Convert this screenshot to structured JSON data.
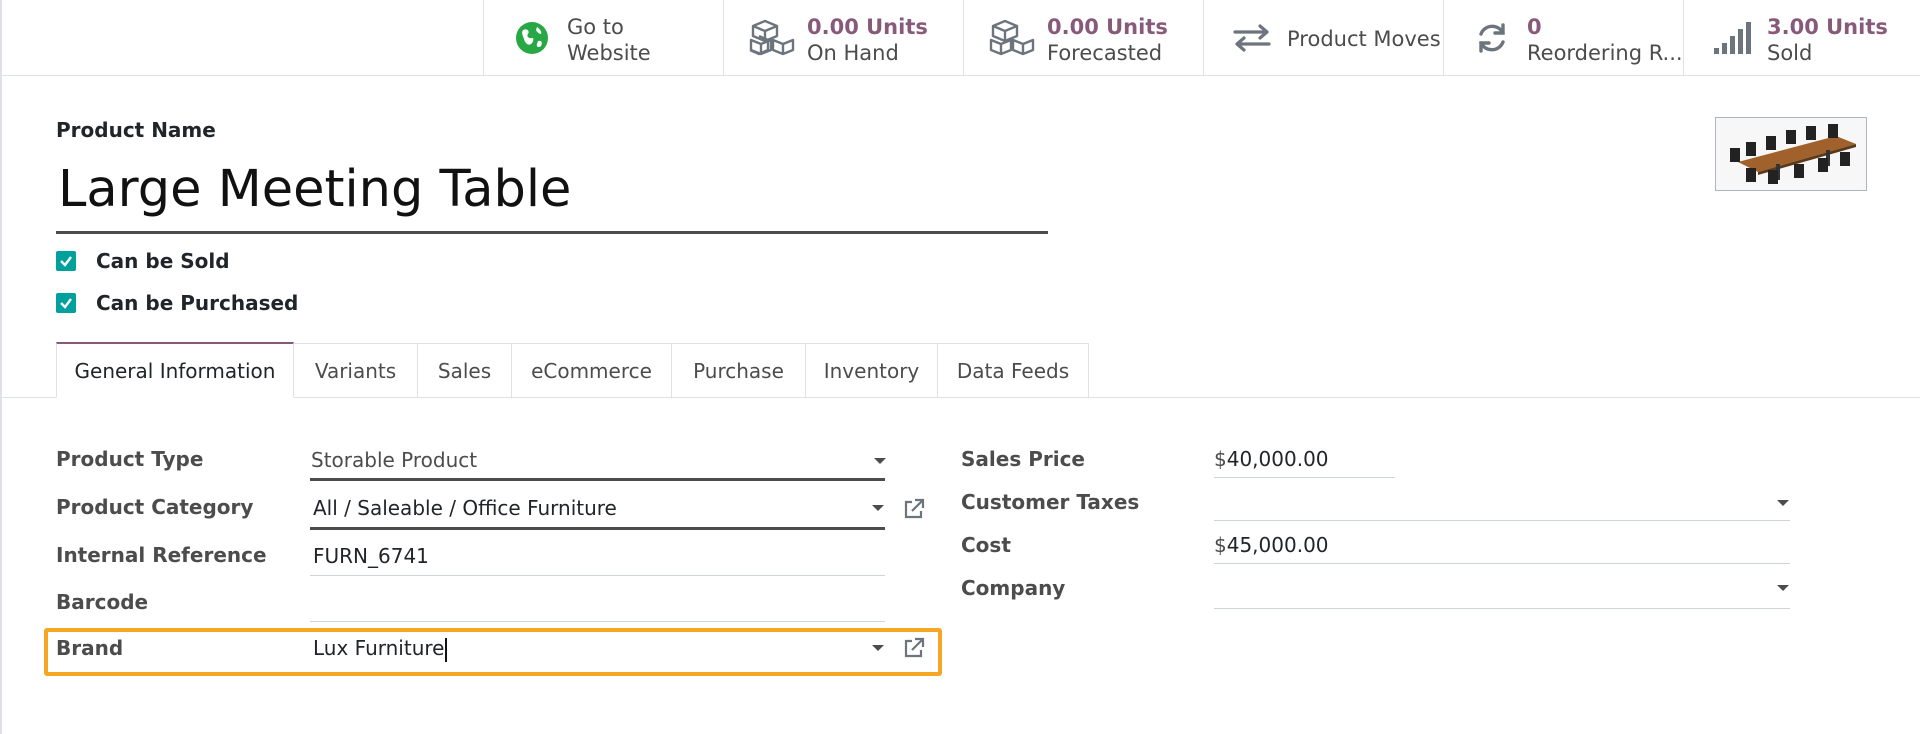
{
  "smart_buttons": [
    {
      "name": "website-button",
      "icon": "globe-icon",
      "value": "",
      "label": "Go to",
      "label2": "Website"
    },
    {
      "name": "on-hand-button",
      "icon": "cubes-icon",
      "value": "0.00 Units",
      "label": "On Hand"
    },
    {
      "name": "forecasted-button",
      "icon": "cubes-icon",
      "value": "0.00 Units",
      "label": "Forecasted"
    },
    {
      "name": "product-moves-button",
      "icon": "exchange-arrows-icon",
      "value": "",
      "label": "Product Moves"
    },
    {
      "name": "reordering-button",
      "icon": "refresh-icon",
      "value": "0",
      "label": "Reordering R..."
    },
    {
      "name": "sold-button",
      "icon": "signal-bars-icon",
      "value": "3.00 Units",
      "label": "Sold"
    }
  ],
  "product": {
    "name_label": "Product Name",
    "name": "Large Meeting Table",
    "can_be_sold_label": "Can be Sold",
    "can_be_sold": true,
    "can_be_purchased_label": "Can be Purchased",
    "can_be_purchased": true
  },
  "tabs": [
    {
      "label": "General Information",
      "active": true
    },
    {
      "label": "Variants"
    },
    {
      "label": "Sales"
    },
    {
      "label": "eCommerce"
    },
    {
      "label": "Purchase"
    },
    {
      "label": "Inventory"
    },
    {
      "label": "Data Feeds"
    }
  ],
  "form_left": {
    "product_type_label": "Product Type",
    "product_type": "Storable Product",
    "product_category_label": "Product Category",
    "product_category": "All / Saleable / Office Furniture",
    "internal_reference_label": "Internal Reference",
    "internal_reference": "FURN_6741",
    "barcode_label": "Barcode",
    "barcode": "",
    "brand_label": "Brand",
    "brand": "Lux Furniture"
  },
  "form_right": {
    "sales_price_label": "Sales Price",
    "sales_price_currency": "$",
    "sales_price": "40,000.00",
    "customer_taxes_label": "Customer Taxes",
    "customer_taxes": "",
    "cost_label": "Cost",
    "cost_currency": "$",
    "cost": "45,000.00",
    "company_label": "Company",
    "company": ""
  },
  "colors": {
    "accent": "#875a7b",
    "checkbox": "#00a09d",
    "highlight": "#f5a623",
    "globe": "#28a745"
  }
}
